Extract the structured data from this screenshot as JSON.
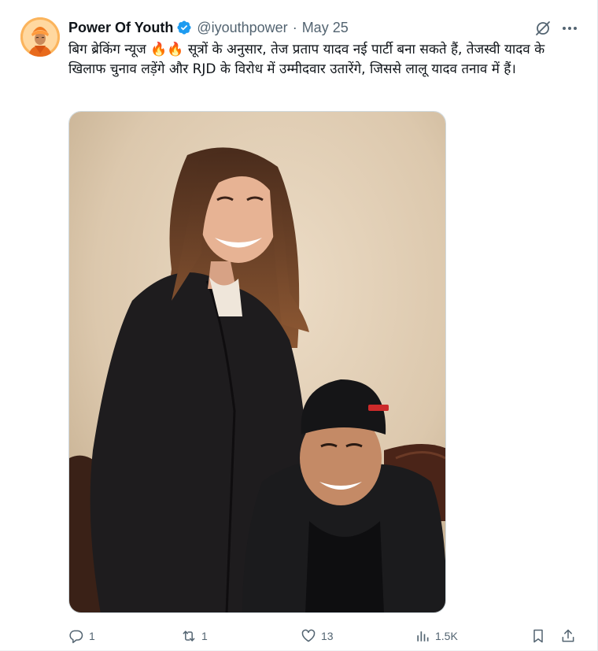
{
  "author": {
    "display_name": "Power Of Youth",
    "handle": "@iyouthpower",
    "separator": "·",
    "date": "May 25"
  },
  "tweet": {
    "text": "बिग ब्रेकिंग न्यूज 🔥🔥 सूत्रों के अनुसार, तेज प्रताप यादव नई पार्टी बना सकते हैं, तेजस्वी यादव के खिलाफ चुनाव लड़ेंगे और RJD के विरोध में उम्मीदवार उतारेंगे, जिससे लालू यादव तनाव में हैं।"
  },
  "actions": {
    "replies": "1",
    "reposts": "1",
    "likes": "13",
    "views": "1.5K"
  },
  "colors": {
    "text": "#0f1419",
    "secondary": "#536471",
    "verified": "#1d9bf0"
  },
  "icons": [
    "grok-icon",
    "more-icon",
    "reply-icon",
    "repost-icon",
    "like-icon",
    "views-icon",
    "bookmark-icon",
    "share-icon",
    "verified-badge-icon"
  ]
}
